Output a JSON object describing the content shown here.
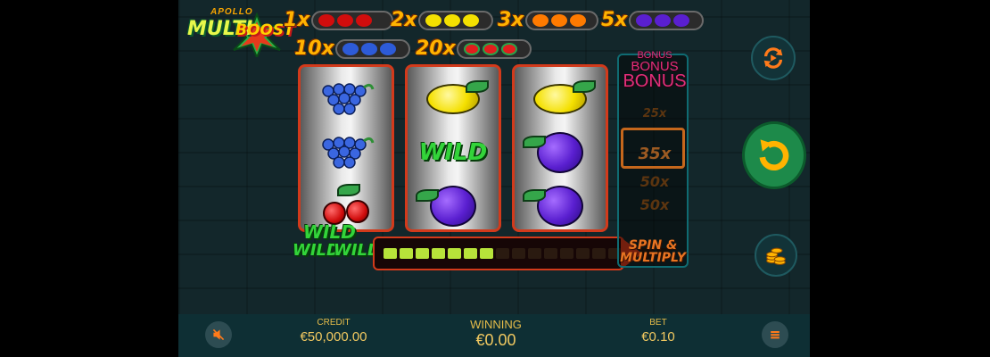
{
  "logo": {
    "brand": "APOLLO",
    "word1": "MULTI",
    "word2": "BOOST"
  },
  "paytable": [
    {
      "multiplier": "1x",
      "symbol": "cherries"
    },
    {
      "multiplier": "2x",
      "symbol": "lemons"
    },
    {
      "multiplier": "3x",
      "symbol": "oranges"
    },
    {
      "multiplier": "5x",
      "symbol": "plums"
    },
    {
      "multiplier": "10x",
      "symbol": "grapes"
    },
    {
      "multiplier": "20x",
      "symbol": "watermelons"
    }
  ],
  "reels": [
    [
      "grapes",
      "grapes",
      "cherries"
    ],
    [
      "lemon",
      "wild",
      "plum"
    ],
    [
      "lemon",
      "plum",
      "plum"
    ]
  ],
  "wild_label": "WILD",
  "progress": {
    "filled_segments": 7,
    "total_segments": 18
  },
  "bonus": {
    "titles": [
      "BONUS",
      "BONUS",
      "BONUS"
    ],
    "multipliers": [
      "25x",
      "35x",
      "50x",
      "50x"
    ],
    "selected": "35x",
    "footer_line1": "SPIN &",
    "footer_line2": "MULTIPLY"
  },
  "bottom_bar": {
    "credit_label": "CREDIT",
    "credit_value": "€50,000.00",
    "winning_label": "WINNING",
    "winning_value": "€0.00",
    "bet_label": "BET",
    "bet_value": "€0.10"
  },
  "icons": {
    "sound": "mute-icon",
    "autoplay": "autoplay-icon",
    "spin": "spin-icon",
    "coins": "coins-icon",
    "menu": "menu-icon"
  },
  "colors": {
    "accent": "#ffb300",
    "reel_border": "#d23a1b",
    "progress_on": "#b7e33a",
    "progress_off": "#2a1a10",
    "spin_button": "#1d8a4a"
  }
}
